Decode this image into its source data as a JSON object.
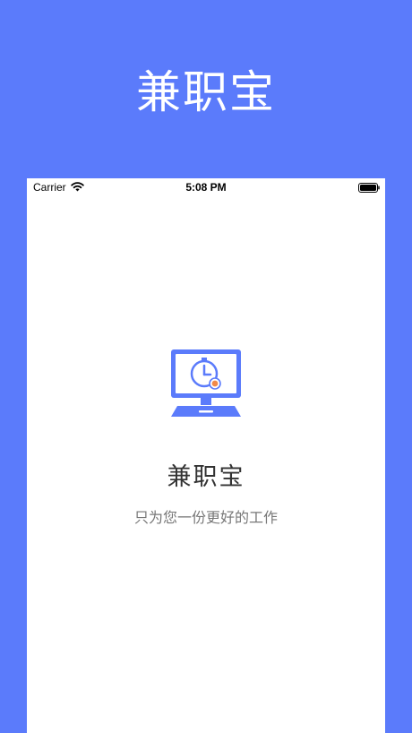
{
  "hero": {
    "title": "兼职宝"
  },
  "status_bar": {
    "carrier": "Carrier",
    "time": "5:08 PM",
    "icons": [
      "wifi-icon",
      "battery-icon"
    ]
  },
  "splash": {
    "logo_icon": "computer-clock-icon",
    "app_name": "兼职宝",
    "tagline": "只为您一份更好的工作"
  },
  "colors": {
    "background": "#5b7bfb",
    "screen": "#ffffff",
    "accent": "#5b7bfb",
    "badge": "#f0894a"
  }
}
